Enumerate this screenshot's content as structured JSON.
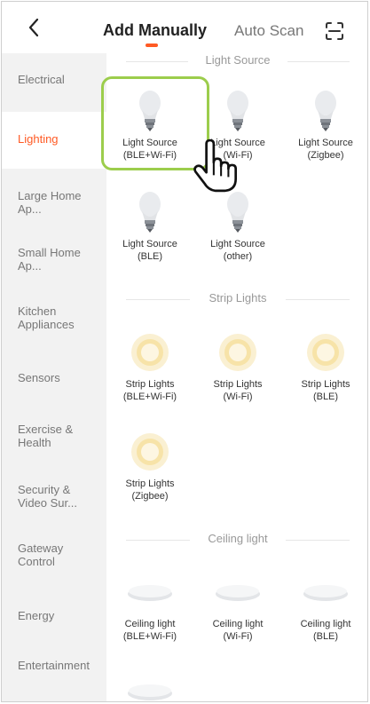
{
  "header": {
    "back_icon": "chevron-left-icon",
    "tabs": [
      {
        "label": "Add Manually",
        "active": true
      },
      {
        "label": "Auto Scan",
        "active": false
      }
    ],
    "scan_icon": "scan-icon",
    "accent_color": "#ff5a24"
  },
  "sidebar": {
    "items": [
      {
        "label": "Electrical",
        "active": false
      },
      {
        "label": "Lighting",
        "active": true
      },
      {
        "label": "Large Home Ap...",
        "active": false
      },
      {
        "label": "Small Home Ap...",
        "active": false
      },
      {
        "label": "Kitchen Appliances",
        "active": false
      },
      {
        "label": "Sensors",
        "active": false
      },
      {
        "label": "Exercise & Health",
        "active": false
      },
      {
        "label": "Security & Video Sur...",
        "active": false
      },
      {
        "label": "Gateway Control",
        "active": false
      },
      {
        "label": "Energy",
        "active": false
      },
      {
        "label": "Entertainment",
        "active": false
      }
    ]
  },
  "sections": [
    {
      "title": "Light Source",
      "devices": [
        {
          "line1": "Light Source",
          "line2": "(BLE+Wi-Fi)",
          "icon": "bulb-icon"
        },
        {
          "line1": "Light Source",
          "line2": "(Wi-Fi)",
          "icon": "bulb-icon"
        },
        {
          "line1": "Light Source",
          "line2": "(Zigbee)",
          "icon": "bulb-icon"
        },
        {
          "line1": "Light Source",
          "line2": "(BLE)",
          "icon": "bulb-icon"
        },
        {
          "line1": "Light Source",
          "line2": "(other)",
          "icon": "bulb-icon"
        }
      ]
    },
    {
      "title": "Strip Lights",
      "devices": [
        {
          "line1": "Strip Lights",
          "line2": "(BLE+Wi-Fi)",
          "icon": "strip-light-icon"
        },
        {
          "line1": "Strip Lights",
          "line2": "(Wi-Fi)",
          "icon": "strip-light-icon"
        },
        {
          "line1": "Strip Lights",
          "line2": "(BLE)",
          "icon": "strip-light-icon"
        },
        {
          "line1": "Strip Lights",
          "line2": "(Zigbee)",
          "icon": "strip-light-icon"
        }
      ]
    },
    {
      "title": "Ceiling light",
      "devices": [
        {
          "line1": "Ceiling light",
          "line2": "(BLE+Wi-Fi)",
          "icon": "ceiling-light-icon"
        },
        {
          "line1": "Ceiling light",
          "line2": "(Wi-Fi)",
          "icon": "ceiling-light-icon"
        },
        {
          "line1": "Ceiling light",
          "line2": "(BLE)",
          "icon": "ceiling-light-icon"
        },
        {
          "line1": "",
          "line2": "",
          "icon": "ceiling-light-icon"
        }
      ]
    }
  ],
  "annotation": {
    "highlight_color": "#9ccd4c",
    "pointer_icon": "hand-pointer-icon"
  }
}
